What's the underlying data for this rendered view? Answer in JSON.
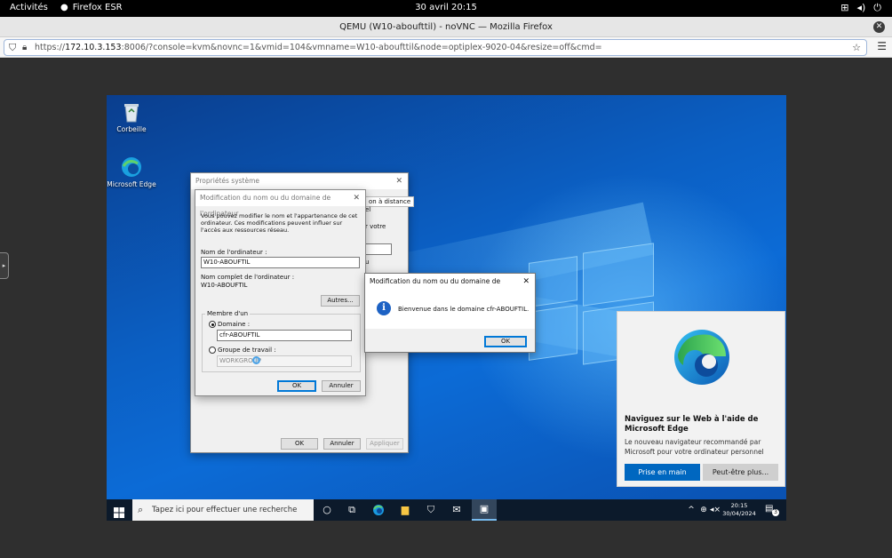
{
  "gnome": {
    "activities": "Activités",
    "app_name": "Firefox ESR",
    "clock": "30 avril  20:15"
  },
  "firefox": {
    "window_title": "QEMU (W10-aboufttil) - noVNC — Mozilla Firefox",
    "url_prefix": "https://",
    "url_host": "172.10.3.153",
    "url_rest": ":8006/?console=kvm&novnc=1&vmid=104&vmname=W10-aboufttil&node=optiplex-9020-04&resize=off&cmd="
  },
  "desktop": {
    "icons": [
      {
        "label": "Corbeille",
        "icon": "recycle-bin-icon"
      },
      {
        "label": "Microsoft Edge",
        "icon": "edge-icon"
      }
    ]
  },
  "system_props": {
    "title": "Propriétés système",
    "tab_fragment": "on à distance",
    "tab_fragment2": "el",
    "partial1": "r votre",
    "partial2": "u",
    "ok": "OK",
    "cancel": "Annuler",
    "apply": "Appliquer"
  },
  "rename_dialog": {
    "title": "Modification du nom ou du domaine de l'ordinateur",
    "intro": "Vous pouvez modifier le nom et l'appartenance de cet ordinateur. Ces modifications peuvent influer sur l'accès aux ressources réseau.",
    "computer_name_label": "Nom de l'ordinateur :",
    "computer_name_value": "W10-ABOUFTIL",
    "full_name_label": "Nom complet de l'ordinateur :",
    "full_name_value": "W10-ABOUFTIL",
    "more_button": "Autres...",
    "member_of": "Membre d'un",
    "domain_label": "Domaine :",
    "domain_value": "cfr-ABOUFTIL",
    "workgroup_label": "Groupe de travail :",
    "workgroup_value": "WORKGROUP",
    "ok": "OK",
    "cancel": "Annuler"
  },
  "welcome_dialog": {
    "title": "Modification du nom ou du domaine de l'ordinateur",
    "message": "Bienvenue dans le domaine cfr-ABOUFTIL.",
    "ok": "OK"
  },
  "edge_promo": {
    "heading": "Naviguez sur le Web à l'aide de Microsoft Edge",
    "body": "Le nouveau navigateur recommandé par Microsoft pour votre ordinateur personnel",
    "primary": "Prise en main",
    "secondary": "Peut-être plus..."
  },
  "taskbar": {
    "search_placeholder": "Tapez ici pour effectuer une recherche",
    "time": "20:15",
    "date": "30/04/2024",
    "notification_count": "3"
  }
}
